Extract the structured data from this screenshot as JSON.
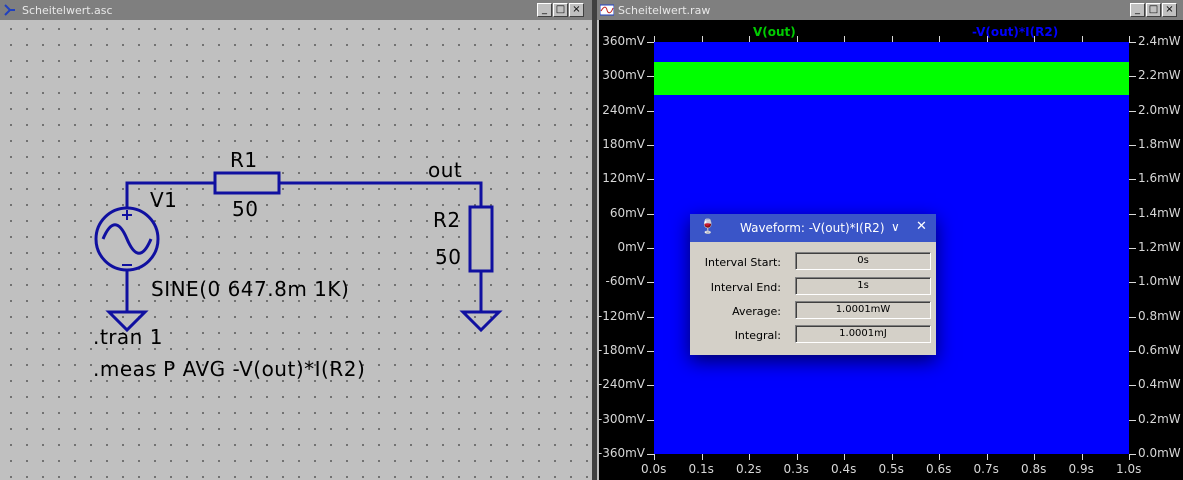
{
  "schematic_window": {
    "title": "Scheitelwert.asc",
    "controls": {
      "minimize": "_",
      "maximize": "□",
      "close": "×"
    },
    "components": {
      "r1_name": "R1",
      "r1_value": "50",
      "v1_name": "V1",
      "v1_value": "SINE(0 647.8m 1K)",
      "r2_name": "R2",
      "r2_value": "50",
      "net_label": "out"
    },
    "directives": [
      ".tran 1",
      ".meas P AVG -V(out)*I(R2)"
    ]
  },
  "waveform_window": {
    "title": "Scheitelwert.raw",
    "controls": {
      "minimize": "_",
      "maximize": "□",
      "close": "×"
    },
    "traces": [
      {
        "name": "V(out)",
        "color": "#00cc00"
      },
      {
        "name": "-V(out)*I(R2)",
        "color": "#0000ff"
      }
    ],
    "left_axis": [
      "360mV",
      "300mV",
      "240mV",
      "180mV",
      "120mV",
      "60mV",
      "0mV",
      "-60mV",
      "-120mV",
      "-180mV",
      "-240mV",
      "-300mV",
      "-360mV"
    ],
    "right_axis": [
      "2.4mW",
      "2.2mW",
      "2.0mW",
      "1.8mW",
      "1.6mW",
      "1.4mW",
      "1.2mW",
      "1.0mW",
      "0.8mW",
      "0.6mW",
      "0.4mW",
      "0.2mW",
      "0.0mW"
    ],
    "x_axis": [
      "0.0s",
      "0.1s",
      "0.2s",
      "0.3s",
      "0.4s",
      "0.5s",
      "0.6s",
      "0.7s",
      "0.8s",
      "0.9s",
      "1.0s"
    ],
    "colors": {
      "background": "#000000",
      "fill_power": "#0000ff",
      "fill_voltage": "#00ff00",
      "axis_text": "#d8d8d8"
    }
  },
  "dialog": {
    "title": "Waveform: -V(out)*I(R2)",
    "fields": [
      {
        "label": "Interval Start:",
        "value": "0s"
      },
      {
        "label": "Interval End:",
        "value": "1s"
      },
      {
        "label": "Average:",
        "value": "1.0001mW"
      },
      {
        "label": "Integral:",
        "value": "1.0001mJ"
      }
    ]
  }
}
